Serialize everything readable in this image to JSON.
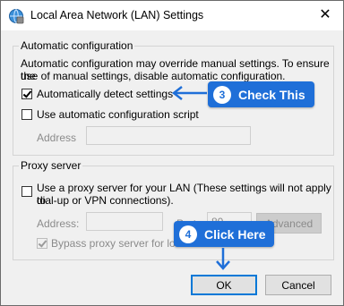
{
  "window": {
    "title": "Local Area Network (LAN) Settings",
    "close_glyph": "✕"
  },
  "auto_config": {
    "group_title": "Automatic configuration",
    "description_line1": "Automatic configuration may override manual settings.  To ensure the",
    "description_line2": "use of manual settings, disable automatic configuration.",
    "detect_label": "Automatically detect settings",
    "detect_checked": true,
    "script_label": "Use automatic configuration script",
    "script_checked": false,
    "address_label": "Address",
    "address_value": ""
  },
  "proxy": {
    "group_title": "Proxy server",
    "use_proxy_line1": "Use a proxy server for your LAN (These settings will not apply to",
    "use_proxy_line2": "dial-up or VPN connections).",
    "use_proxy_checked": false,
    "address_label": "Address:",
    "address_value": "",
    "port_label": "Port:",
    "port_value": "80",
    "advanced_label": "Advanced",
    "bypass_label": "Bypass proxy server for local addresses",
    "bypass_checked": true
  },
  "buttons": {
    "ok": "OK",
    "cancel": "Cancel"
  },
  "annotations": {
    "callout3_number": "3",
    "callout3_text": "Check This",
    "callout4_number": "4",
    "callout4_text": "Click Here",
    "accent_color": "#1f6fd8"
  },
  "icons": [
    "network-settings-icon",
    "close-icon",
    "arrow-left-icon",
    "arrow-down-icon"
  ]
}
